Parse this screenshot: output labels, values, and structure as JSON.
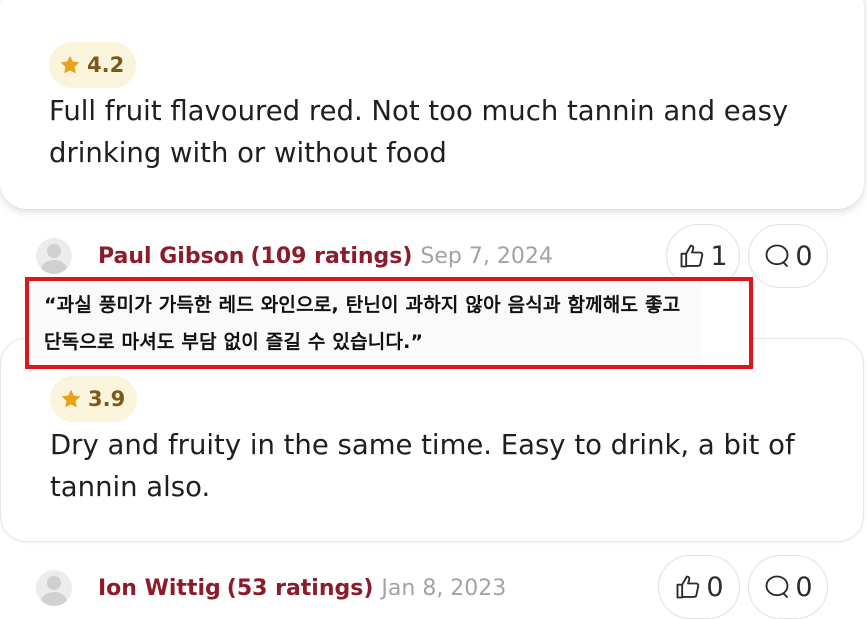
{
  "reviews": [
    {
      "rating": "4.2",
      "text": "Full fruit flavoured red. Not too much tannin and easy drinking with or without food"
    },
    {
      "author": "Paul Gibson",
      "ratings_count": "(109 ratings)",
      "date": "Sep 7, 2024",
      "likes": "1",
      "comments": "0",
      "rating": "3.9",
      "text": "Dry and fruity in the same time. Easy to drink, a bit of tannin also."
    },
    {
      "author": "Ion Wittig",
      "ratings_count": "(53 ratings)",
      "date": "Jan 8, 2023",
      "likes": "0",
      "comments": "0"
    }
  ],
  "translation": {
    "text": "“과실 풍미가 가득한 레드 와인으로, 탄닌이 과하지 않아 음식과 함께해도 좋고 단독으로 마셔도 부담 없이 즐길 수 있습니다.”",
    "highlight_color": "#e0141c"
  },
  "icons": {
    "star": "star-icon",
    "like": "thumbs-up-icon",
    "comment": "speech-bubble-icon"
  },
  "colors": {
    "author": "#8c1b2b",
    "rating_pill_bg": "#fbf4dc",
    "star": "#e8a21c",
    "date": "#a3a3a3"
  }
}
